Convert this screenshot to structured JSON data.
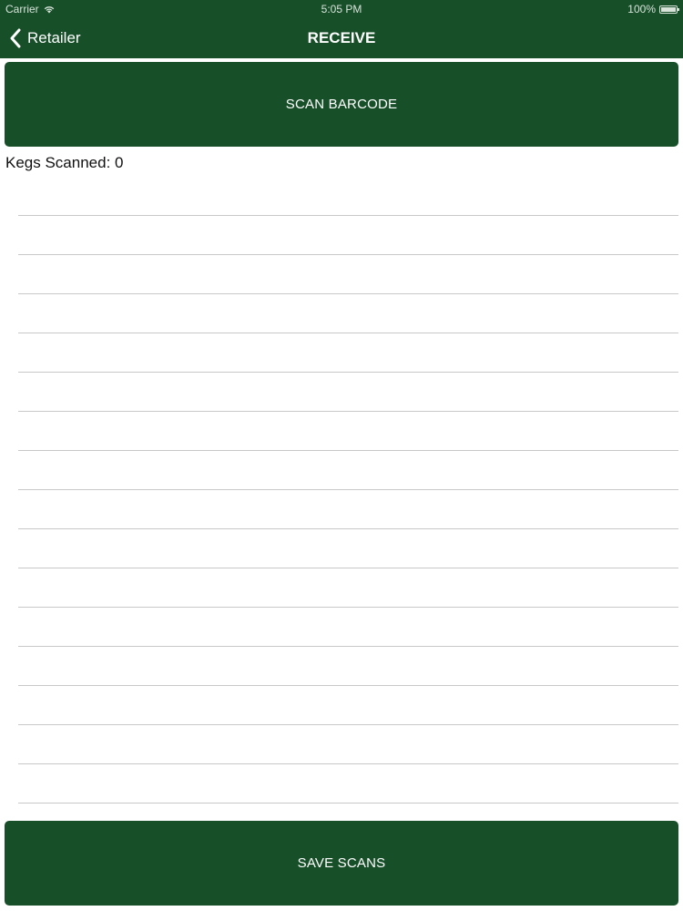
{
  "status": {
    "carrier": "Carrier",
    "time": "5:05 PM",
    "battery": "100%"
  },
  "nav": {
    "back_label": "Retailer",
    "title": "RECEIVE"
  },
  "main": {
    "scan_button_label": "SCAN BARCODE",
    "kegs_scanned_text": "Kegs Scanned: 0",
    "save_button_label": "SAVE SCANS",
    "empty_rows": 16
  },
  "colors": {
    "brand_green": "#174f29",
    "divider": "#c8c8c8"
  },
  "icons": {
    "back": "chevron-left-icon",
    "wifi": "wifi-icon",
    "battery": "battery-icon"
  }
}
